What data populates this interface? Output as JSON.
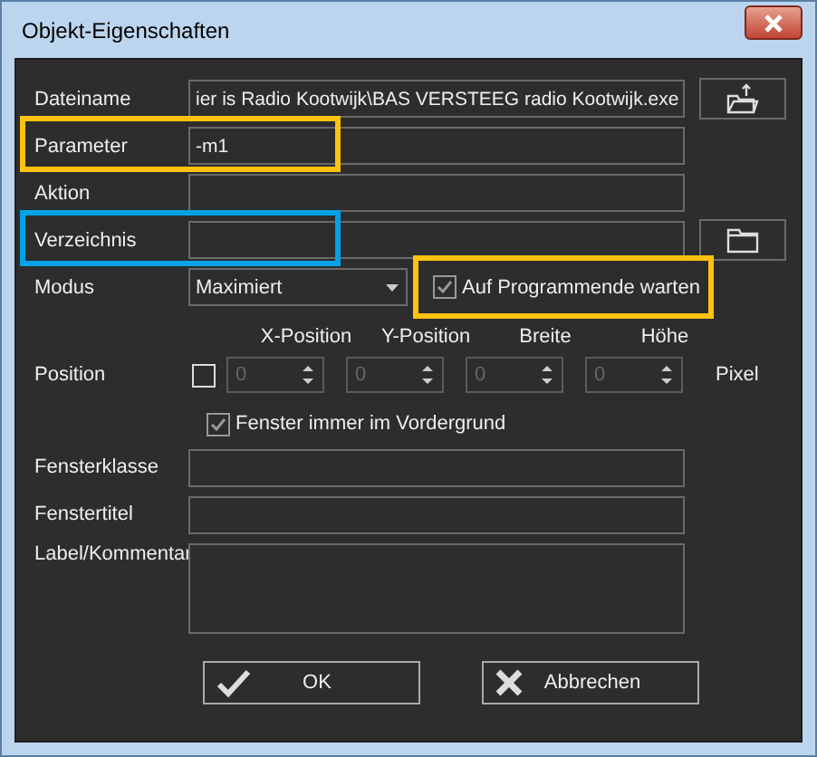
{
  "window": {
    "title": "Objekt-Eigenschaften"
  },
  "fields": [
    {
      "label": "Dateiname",
      "value": "ier is Radio Kootwijk\\BAS VERSTEEG radio Kootwijk.exe",
      "kind": "file"
    },
    {
      "label": "Parameter",
      "value": "-m1",
      "kind": "text",
      "color": "#ffc20e"
    },
    {
      "label": "Aktion",
      "kind": "text"
    },
    {
      "label": "Verzeichnis",
      "kind": "folder",
      "color": "#00a2e8"
    }
  ],
  "mode": {
    "label": "Modus",
    "value": "Maximiert"
  },
  "wait": {
    "label": "Auf Programmende warten",
    "checked": true,
    "color": "#ffc20e"
  },
  "position": {
    "label": "Position",
    "checked": false,
    "columns": [
      "X-Position",
      "Y-Position",
      "Breite",
      "Höhe"
    ],
    "spinners": [
      {
        "value": "0"
      },
      {
        "value": "0"
      },
      {
        "value": "0"
      },
      {
        "value": "0"
      }
    ],
    "unit": "Pixel"
  },
  "topmost": {
    "label": "Fenster immer im Vordergrund",
    "checked": true
  },
  "lower_fields": [
    {
      "label": "Fensterklasse",
      "kind": "line"
    },
    {
      "label": "Fenstertitel",
      "kind": "line"
    },
    {
      "label": "Label/Kommentar",
      "kind": "multiline"
    }
  ],
  "buttons": [
    {
      "label": "OK",
      "kind": "ok"
    },
    {
      "label": "Abbrechen",
      "kind": "cancel"
    }
  ]
}
